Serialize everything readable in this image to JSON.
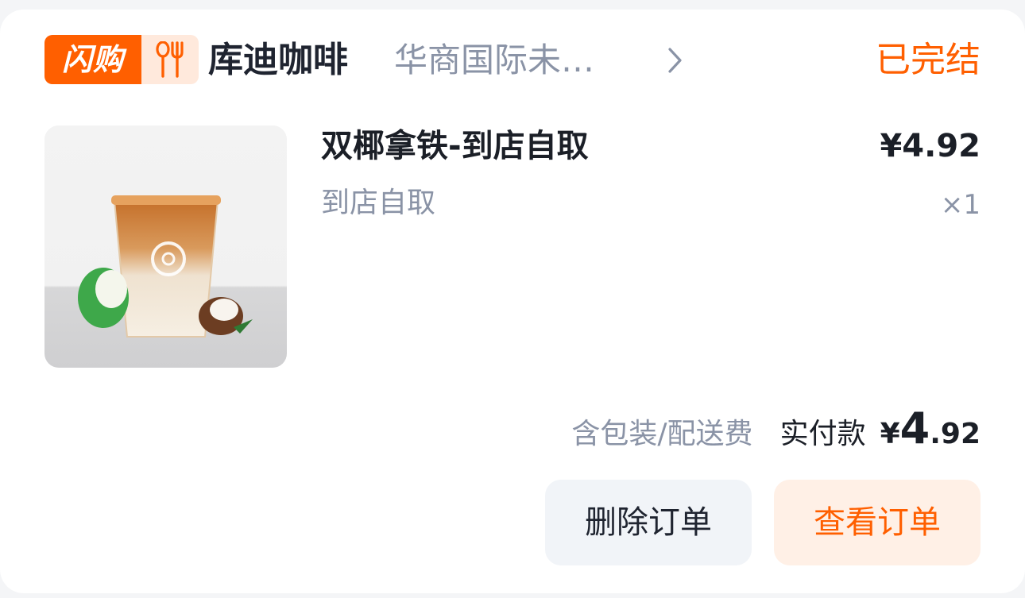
{
  "order": {
    "flash_label": "闪购",
    "store_name": "库迪咖啡",
    "store_branch": "华商国际未…",
    "status": "已完结",
    "colors": {
      "accent": "#ff5f00",
      "accent_light": "#fff0e6",
      "muted": "#8a93a6"
    },
    "icons": {
      "category": "utensils-icon",
      "more": "chevron-right-icon"
    }
  },
  "product": {
    "title": "双椰拿铁-到店自取",
    "price": "¥4.92",
    "sub": "到店自取",
    "qty": "×1"
  },
  "summary": {
    "fee_note": "含包装/配送费",
    "paid_label": "实付款",
    "currency": "¥",
    "amount_int": "4",
    "amount_dec": ".92"
  },
  "actions": {
    "delete_label": "删除订单",
    "view_label": "查看订单"
  }
}
